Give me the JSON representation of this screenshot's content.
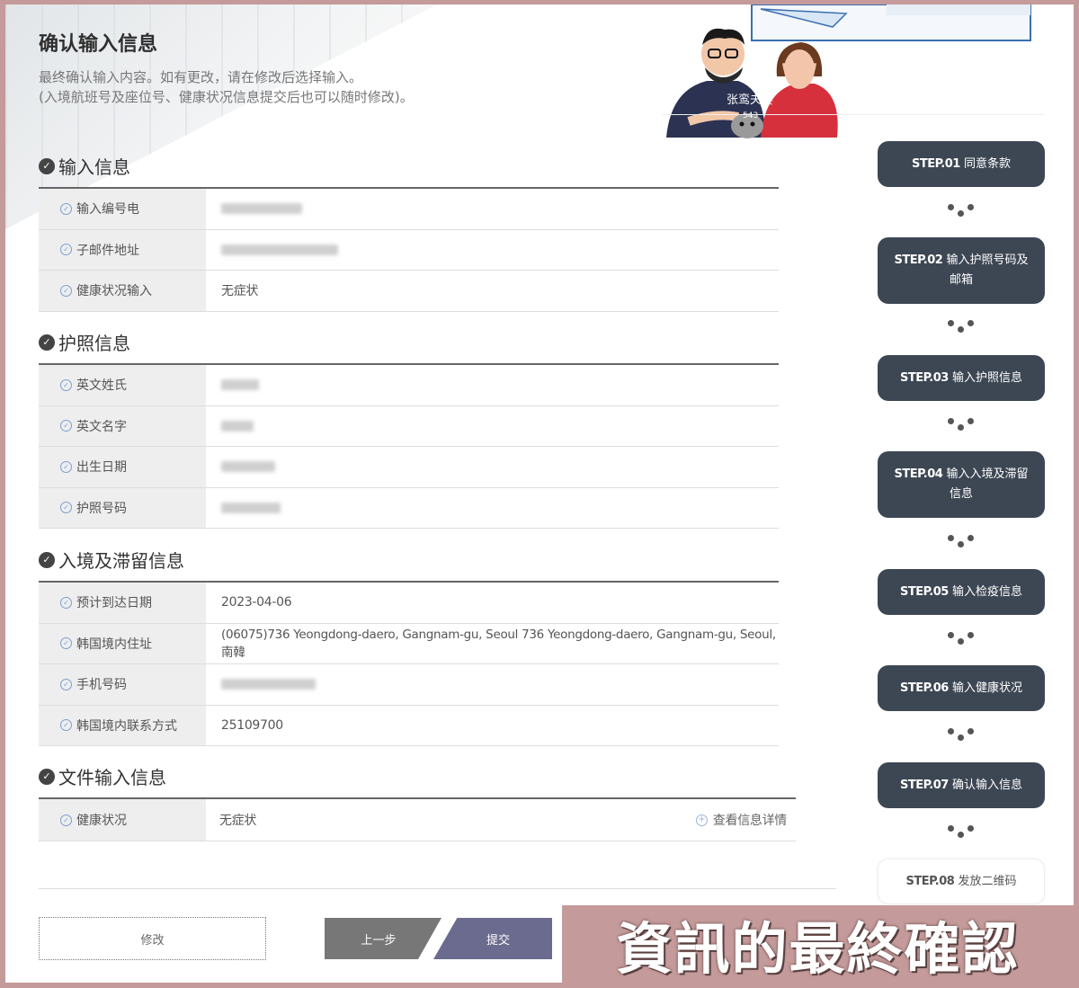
{
  "header": {
    "title": "确认输入信息",
    "desc_line1": "最终确认输入内容。如有更改，请在修改后选择输入。",
    "desc_line2": "(入境航班号及座位号、健康状况信息提交后也可以随时修改)。"
  },
  "illustration": {
    "sign_text": "张鸾夫妻",
    "sign_sub": "543"
  },
  "sections": {
    "input": {
      "title": "输入信息",
      "rows": [
        {
          "label": "输入编号电",
          "value": ""
        },
        {
          "label": "子邮件地址",
          "value": ""
        },
        {
          "label": "健康状况输入",
          "value": "无症状"
        }
      ]
    },
    "passport": {
      "title": "护照信息",
      "rows": [
        {
          "label": "英文姓氏",
          "value": ""
        },
        {
          "label": "英文名字",
          "value": ""
        },
        {
          "label": "出生日期",
          "value": ""
        },
        {
          "label": "护照号码",
          "value": ""
        }
      ]
    },
    "entry": {
      "title": "入境及滞留信息",
      "rows": [
        {
          "label": "预计到达日期",
          "value": "2023-04-06"
        },
        {
          "label": "韩国境内住址",
          "value": "(06075)736 Yeongdong-daero, Gangnam-gu, Seoul 736 Yeongdong-daero, Gangnam-gu, Seoul, 南韓"
        },
        {
          "label": "手机号码",
          "value": ""
        },
        {
          "label": "韩国境内联系方式",
          "value": "25109700"
        }
      ]
    },
    "files": {
      "title": "文件输入信息",
      "rows": [
        {
          "label": "健康状况",
          "value": "无症状",
          "link": "查看信息详情"
        }
      ]
    }
  },
  "buttons": {
    "edit": "修改",
    "prev": "上一步",
    "submit": "提交"
  },
  "steps": [
    {
      "num": "STEP.01",
      "label": "同意条款"
    },
    {
      "num": "STEP.02",
      "label": "输入护照号码及邮箱"
    },
    {
      "num": "STEP.03",
      "label": "输入护照信息"
    },
    {
      "num": "STEP.04",
      "label": "输入入境及滞留信息"
    },
    {
      "num": "STEP.05",
      "label": "输入检疫信息"
    },
    {
      "num": "STEP.06",
      "label": "输入健康状况"
    },
    {
      "num": "STEP.07",
      "label": "确认输入信息"
    },
    {
      "num": "STEP.08",
      "label": "发放二维码"
    }
  ],
  "caption": "資訊的最終確認",
  "colors": {
    "step_bg": "#3d4754",
    "submit": "#6b6b8f",
    "prev": "#777777",
    "caption_bg": "#c49a9a"
  }
}
